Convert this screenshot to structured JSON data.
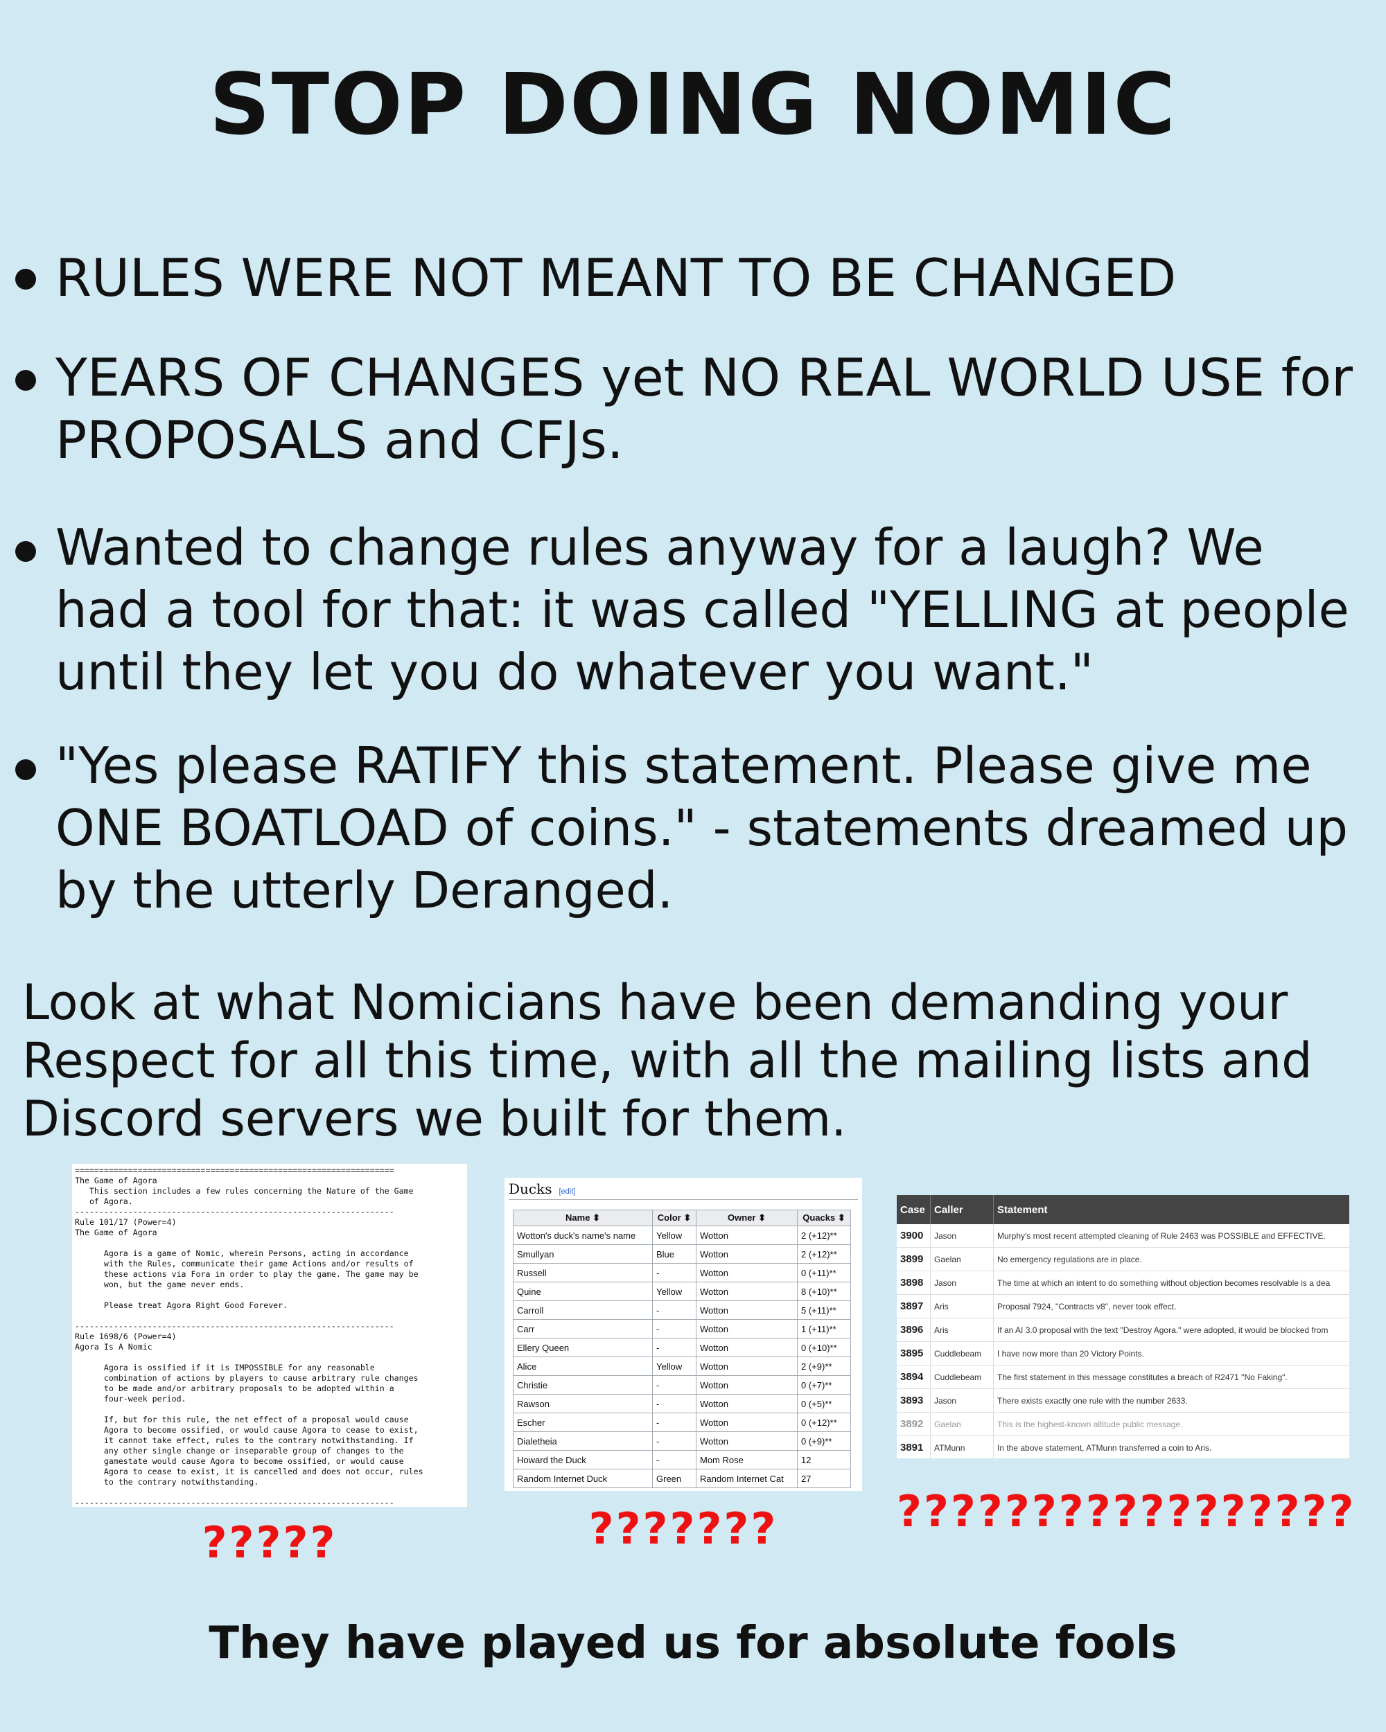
{
  "title": "STOP DOING NOMIC",
  "bullets": [
    "RULES WERE NOT MEANT TO BE CHANGED",
    "YEARS OF CHANGES yet NO REAL WORLD USE for PROPOSALS and CFJs.",
    "Wanted to change rules anyway for a laugh? We had a tool for that: it was called \"YELLING at people until they let you do whatever you want.\"",
    "\"Yes please RATIFY this statement. Please give me ONE BOATLOAD of coins.\" - statements dreamed up by the utterly Deranged."
  ],
  "look_at": "Look at what Nomicians have been demanding your Respect for all this time, with all the mailing lists and Discord servers we built for them.",
  "panel1": {
    "text": "==================================================================\nThe Game of Agora\n   This section includes a few rules concerning the Nature of the Game\n   of Agora.\n------------------------------------------------------------------\nRule 101/17 (Power=4)\nThe Game of Agora\n\n      Agora is a game of Nomic, wherein Persons, acting in accordance\n      with the Rules, communicate their game Actions and/or results of\n      these actions via Fora in order to play the game. The game may be\n      won, but the game never ends.\n\n      Please treat Agora Right Good Forever.\n\n------------------------------------------------------------------\nRule 1698/6 (Power=4)\nAgora Is A Nomic\n\n      Agora is ossified if it is IMPOSSIBLE for any reasonable\n      combination of actions by players to cause arbitrary rule changes\n      to be made and/or arbitrary proposals to be adopted within a\n      four-week period.\n\n      If, but for this rule, the net effect of a proposal would cause\n      Agora to become ossified, or would cause Agora to cease to exist,\n      it cannot take effect, rules to the contrary notwithstanding. If\n      any other single change or inseparable group of changes to the\n      gamestate would cause Agora to become ossified, or would cause\n      Agora to cease to exist, it is cancelled and does not occur, rules\n      to the contrary notwithstanding.\n\n------------------------------------------------------------------",
    "caption": "?????"
  },
  "panel2": {
    "heading": "Ducks",
    "edit_link": "[edit]",
    "columns": [
      "Name",
      "Color",
      "Owner",
      "Quacks"
    ],
    "rows": [
      [
        "Wotton's duck's name's name",
        "Yellow",
        "Wotton",
        "2 (+12)**"
      ],
      [
        "Smullyan",
        "Blue",
        "Wotton",
        "2 (+12)**"
      ],
      [
        "Russell",
        "-",
        "Wotton",
        "0 (+11)**"
      ],
      [
        "Quine",
        "Yellow",
        "Wotton",
        "8 (+10)**"
      ],
      [
        "Carroll",
        "-",
        "Wotton",
        "5 (+11)**"
      ],
      [
        "Carr",
        "-",
        "Wotton",
        "1 (+11)**"
      ],
      [
        "Ellery Queen",
        "-",
        "Wotton",
        "0 (+10)**"
      ],
      [
        "Alice",
        "Yellow",
        "Wotton",
        "2 (+9)**"
      ],
      [
        "Christie",
        "-",
        "Wotton",
        "0 (+7)**"
      ],
      [
        "Rawson",
        "-",
        "Wotton",
        "0 (+5)**"
      ],
      [
        "Escher",
        "-",
        "Wotton",
        "0 (+12)**"
      ],
      [
        "Dialetheia",
        "-",
        "Wotton",
        "0 (+9)**"
      ],
      [
        "Howard the Duck",
        "-",
        "Mom Rose",
        "12"
      ],
      [
        "Random Internet Duck",
        "Green",
        "Random Internet Cat",
        "27"
      ]
    ],
    "caption": "???????"
  },
  "panel3": {
    "columns": [
      "Case",
      "Caller",
      "Statement"
    ],
    "rows": [
      [
        "3900",
        "Jason",
        "Murphy's most recent attempted cleaning of Rule 2463 was POSSIBLE and EFFECTIVE."
      ],
      [
        "3899",
        "Gaelan",
        "No emergency regulations are in place."
      ],
      [
        "3898",
        "Jason",
        "The time at which an intent to do something without objection becomes resolvable is a dea"
      ],
      [
        "3897",
        "Aris",
        "Proposal 7924, \"Contracts v8\", never took effect."
      ],
      [
        "3896",
        "Aris",
        "If an AI 3.0 proposal with the text \"Destroy Agora.\" were adopted, it would be blocked from"
      ],
      [
        "3895",
        "Cuddlebeam",
        "I have now more than 20 Victory Points."
      ],
      [
        "3894",
        "Cuddlebeam",
        "The first statement in this message constitutes a breach of R2471 \"No Faking\"."
      ],
      [
        "3893",
        "Jason",
        "There exists exactly one rule with the number 2633."
      ],
      [
        "3892",
        "Gaelan",
        "This is the highest-known altitude public message."
      ],
      [
        "3891",
        "ATMunn",
        "In the above statement, ATMunn transferred a coin to Aris."
      ]
    ],
    "dim_row": 8,
    "caption": "?????????????????"
  },
  "footer": "They have played us for absolute fools"
}
